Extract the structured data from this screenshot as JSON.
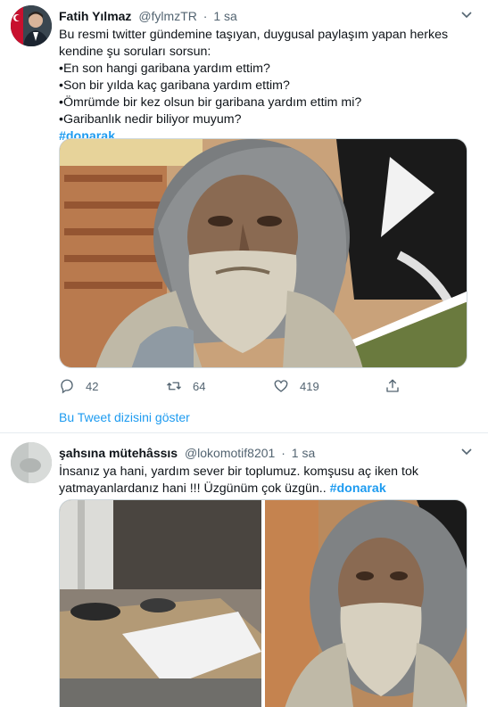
{
  "tweet1": {
    "name": "Fatih Yılmaz",
    "handle": "@fylmzTR",
    "dot": "·",
    "time": "1 sa",
    "lines": [
      "Bu resmi twitter gündemine taşıyan, duygusal paylaşım yapan herkes",
      "kendine şu soruları sorsun:",
      "•En son hangi garibana yardım ettim?",
      "•Son bir yılda kaç garibana yardım ettim?",
      "•Ömrümde bir kez olsun bir garibana yardım ettim mi?",
      "•Garibanlık nedir biliyor muyum?"
    ],
    "hashtag": "#donarak",
    "actions": {
      "replies": "42",
      "retweets": "64",
      "likes": "419"
    },
    "thread_link": "Bu Tweet dizisini göster"
  },
  "tweet2": {
    "name": "şahsına mütehâssıs",
    "handle": "@lokomotif8201",
    "dot": "·",
    "time": "1 sa",
    "line1": "İnsanız ya hani, yardım sever bir toplumuz. komşusu aç iken tok",
    "line2_text": "yatmayanlardanız hani !!! Üzgünüm çok üzgün.. ",
    "hashtag": "#donarak"
  },
  "icons": {
    "caret": "chevron-down-icon",
    "reply": "reply-icon",
    "retweet": "retweet-icon",
    "like": "heart-icon",
    "share": "share-icon"
  },
  "colors": {
    "link": "#1d9bf0",
    "muted": "#536471",
    "text": "#0f1419"
  }
}
